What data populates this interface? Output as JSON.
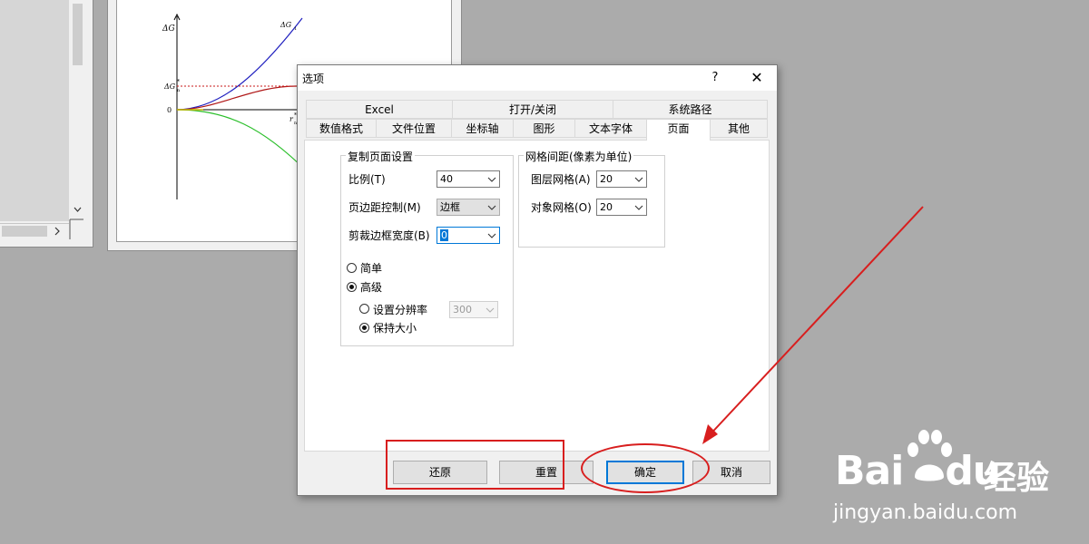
{
  "colors": {
    "annotation": "#d81e1e",
    "accent": "#0078d7"
  },
  "plot": {
    "y_label": "ΔG",
    "g1_label": "ΔG",
    "g1_sub": "1",
    "gn_label": "ΔG",
    "gn_sup": "*",
    "gn_sub": "n",
    "zero_label": "0",
    "r_label": "r",
    "r_sup": "*",
    "r_sub": "n",
    "partial_label": "Δ"
  },
  "dialog": {
    "title": "选项",
    "help_icon": "?",
    "close_icon": "✕",
    "tabs_row1": [
      "Excel",
      "打开/关闭",
      "系统路径"
    ],
    "tabs_row2": [
      "数值格式",
      "文件位置",
      "坐标轴",
      "图形",
      "文本字体",
      "页面",
      "其他"
    ],
    "active_tab": "页面",
    "copy_group": {
      "legend": "复制页面设置",
      "scale_label": "比例(T)",
      "scale_value": "40",
      "margin_label": "页边距控制(M)",
      "margin_value": "边框",
      "crop_label": "剪裁边框宽度(B)",
      "crop_value": "0",
      "simple_label": "简单",
      "advanced_label": "高级",
      "resolution_label": "设置分辨率",
      "resolution_value": "300",
      "keep_size_label": "保持大小"
    },
    "grid_group": {
      "legend": "网格间距(像素为单位)",
      "layer_grid_label": "图层网格(A)",
      "layer_grid_value": "20",
      "object_grid_label": "对象网格(O)",
      "object_grid_value": "20"
    },
    "buttons": {
      "restore": "还原",
      "reset": "重置",
      "ok": "确定",
      "cancel": "取消"
    }
  },
  "watermark": {
    "brand": "Bai",
    "brand_tail": "du",
    "site": "经验",
    "url": "jingyan.baidu.com"
  }
}
